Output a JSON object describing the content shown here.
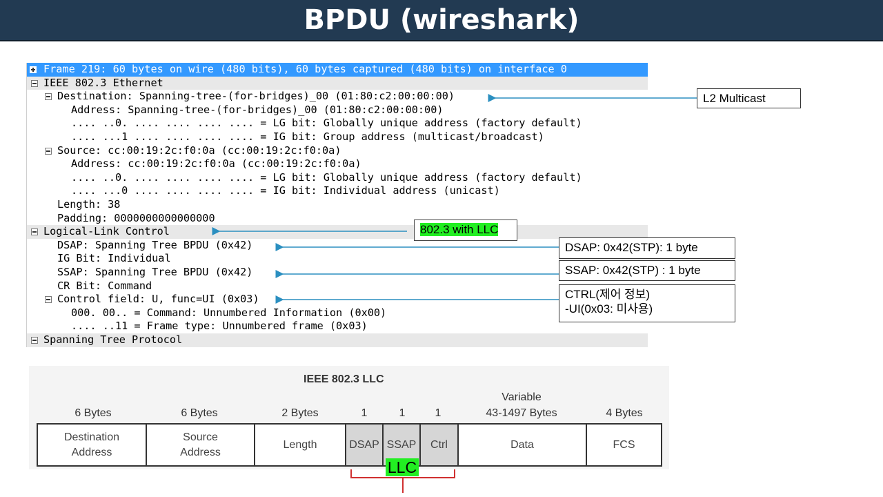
{
  "slide": {
    "title": "BPDU (wireshark)"
  },
  "packet_tree": {
    "rows": [
      {
        "text": "Frame 219: 60 bytes on wire (480 bits), 60 bytes captured (480 bits) on interface 0",
        "toggle": "plus"
      },
      {
        "text": "IEEE 802.3 Ethernet",
        "toggle": "minus"
      },
      {
        "text": "Destination: Spanning-tree-(for-bridges)_00 (01:80:c2:00:00:00)",
        "toggle": "minus"
      },
      {
        "text": "Address: Spanning-tree-(for-bridges)_00 (01:80:c2:00:00:00)",
        "toggle": "none"
      },
      {
        "text": ".... ..0. .... .... .... .... = LG bit: Globally unique address (factory default)",
        "toggle": "none"
      },
      {
        "text": ".... ...1 .... .... .... .... = IG bit: Group address (multicast/broadcast)",
        "toggle": "none"
      },
      {
        "text": "Source: cc:00:19:2c:f0:0a (cc:00:19:2c:f0:0a)",
        "toggle": "minus"
      },
      {
        "text": "Address: cc:00:19:2c:f0:0a (cc:00:19:2c:f0:0a)",
        "toggle": "none"
      },
      {
        "text": ".... ..0. .... .... .... .... = LG bit: Globally unique address (factory default)",
        "toggle": "none"
      },
      {
        "text": ".... ...0 .... .... .... .... = IG bit: Individual address (unicast)",
        "toggle": "none"
      },
      {
        "text": "Length: 38",
        "toggle": "none"
      },
      {
        "text": "Padding: 0000000000000000",
        "toggle": "none"
      },
      {
        "text": "Logical-Link Control",
        "toggle": "minus"
      },
      {
        "text": "DSAP: Spanning Tree BPDU (0x42)",
        "toggle": "none"
      },
      {
        "text": "IG Bit: Individual",
        "toggle": "none"
      },
      {
        "text": "SSAP: Spanning Tree BPDU (0x42)",
        "toggle": "none"
      },
      {
        "text": "CR Bit: Command",
        "toggle": "none"
      },
      {
        "text": "Control field: U, func=UI (0x03)",
        "toggle": "minus"
      },
      {
        "text": "000. 00.. = Command: Unnumbered Information (0x00)",
        "toggle": "none"
      },
      {
        "text": ".... ..11 = Frame type: Unnumbered frame (0x03)",
        "toggle": "none"
      },
      {
        "text": "Spanning Tree Protocol",
        "toggle": "minus"
      }
    ]
  },
  "annotations": {
    "l2_multicast": "L2 Multicast",
    "llc_note": "802.3 with LLC",
    "dsap_note": "DSAP: 0x42(STP): 1 byte",
    "ssap_note": "SSAP: 0x42(STP) : 1 byte",
    "ctrl_note_line1": "CTRL(제어 정보)",
    "ctrl_note_line2": "-UI(0x03: 미사용)"
  },
  "llc_frame": {
    "title": "IEEE 802.3 LLC",
    "sizes": [
      "6 Bytes",
      "6 Bytes",
      "2 Bytes",
      "1",
      "1",
      "1",
      "Variable",
      "43-1497 Bytes",
      "4 Bytes"
    ],
    "fields": [
      "Destination",
      "Address",
      "Source",
      "Address",
      "Length",
      "DSAP",
      "SSAP",
      "Ctrl",
      "Data",
      "FCS"
    ],
    "llc_label": "LLC"
  },
  "colors": {
    "banner": "#223a52",
    "selected_row": "#3399ff",
    "section_row": "#e8e8e8",
    "arrow": "#2b8fc0",
    "highlight_green": "#22ee22",
    "brace": "#d03030"
  }
}
